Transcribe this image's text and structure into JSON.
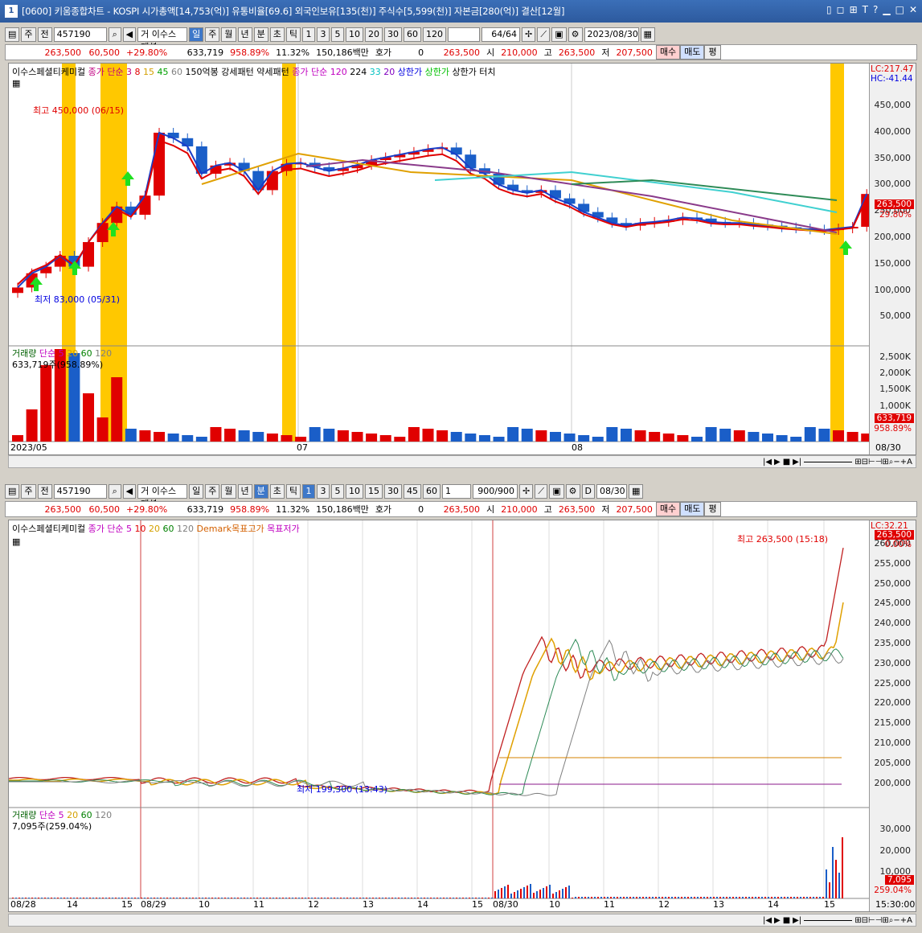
{
  "title": "[0600] 키움종합차트 - KOSPI 시가총액[14,753(억)] 유통비율[69.6] 외국인보유[135(천)] 주식수[5,599(천)] 자본금[280(억)] 결산[12월]",
  "window_num": "1",
  "win_controls": [
    "▯",
    "◻",
    "⊞",
    "T",
    "?",
    "▁",
    "□",
    "✕"
  ],
  "top": {
    "toolbar": {
      "mode": "주",
      "scope": "전",
      "code": "457190",
      "name": "거 이수스페셜",
      "periods": [
        "일",
        "주",
        "월",
        "년",
        "분",
        "초",
        "틱"
      ],
      "active_period": "일",
      "nums": [
        "1",
        "3",
        "5",
        "10",
        "20",
        "30",
        "60",
        "120"
      ],
      "count": "64/64",
      "date": "2023/08/30"
    },
    "quote": {
      "price": "263,500",
      "change": "60,500",
      "pct": "+29.80%",
      "volume": "633,719",
      "vol_pct": "958.89%",
      "turnover": "11.32%",
      "amount": "150,186백만",
      "hoga": "호가",
      "hoga_v": "0",
      "cur": "263,500",
      "open_l": "시",
      "open": "210,000",
      "high_l": "고",
      "high": "263,500",
      "low_l": "저",
      "low": "207,500",
      "buy": "매수",
      "sell": "매도",
      "avg": "평"
    },
    "legend_price": [
      {
        "t": "이수스페셜티케미컬",
        "c": "#000"
      },
      {
        "t": "종가 단순 3",
        "c": "#c00080"
      },
      {
        "t": "8",
        "c": "#e00000"
      },
      {
        "t": "15",
        "c": "#d4a000"
      },
      {
        "t": "45",
        "c": "#00a000"
      },
      {
        "t": "60",
        "c": "#808080"
      },
      {
        "t": "150억봉 강세패턴",
        "c": "#000"
      },
      {
        "t": "약세패턴",
        "c": "#000"
      },
      {
        "t": "종가 단순 120",
        "c": "#c000c0"
      },
      {
        "t": "224",
        "c": "#000"
      },
      {
        "t": "33",
        "c": "#00c0c0"
      },
      {
        "t": "20",
        "c": "#8000c0"
      },
      {
        "t": "상한가",
        "c": "#0000e0"
      },
      {
        "t": "상한가",
        "c": "#00c000"
      },
      {
        "t": "상한가 터치",
        "c": "#000"
      }
    ],
    "max_note": "최고 450,000 (06/15)",
    "min_note": "최저 83,000 (05/31)",
    "lc": "LC:217.47",
    "hc": "HC:-41.44",
    "y_ticks": [
      "450,000",
      "400,000",
      "350,000",
      "300,000",
      "250,000",
      "200,000",
      "150,000",
      "100,000",
      "50,000"
    ],
    "price_tag": "263,500",
    "price_pct": "29.80%",
    "legend_vol": [
      {
        "t": "거래량",
        "c": "#006000"
      },
      {
        "t": "단순 5",
        "c": "#c000c0"
      },
      {
        "t": "20",
        "c": "#d4a000"
      },
      {
        "t": "60",
        "c": "#008000"
      },
      {
        "t": "120",
        "c": "#808080"
      }
    ],
    "vol_note": "633,719주(958.89%)",
    "vol_ticks": [
      "2,500K",
      "2,000K",
      "1,500K",
      "1,000K"
    ],
    "vol_tag": "633,719",
    "vol_pct_tag": "958.89%",
    "x_ticks": [
      "2023/05",
      "07",
      "08"
    ],
    "x_end": "08/30"
  },
  "bottom": {
    "toolbar": {
      "mode": "주",
      "scope": "전",
      "code": "457190",
      "name": "거 이수스페셜",
      "periods": [
        "일",
        "주",
        "월",
        "년",
        "분",
        "초",
        "틱"
      ],
      "active_period": "분",
      "nums": [
        "1",
        "3",
        "5",
        "10",
        "15",
        "30",
        "45",
        "60"
      ],
      "active_num": "1",
      "unit": "1",
      "count": "900/900",
      "date": "08/30",
      "d": "D"
    },
    "quote": {
      "price": "263,500",
      "change": "60,500",
      "pct": "+29.80%",
      "volume": "633,719",
      "vol_pct": "958.89%",
      "turnover": "11.32%",
      "amount": "150,186백만",
      "hoga": "호가",
      "hoga_v": "0",
      "cur": "263,500",
      "open_l": "시",
      "open": "210,000",
      "high_l": "고",
      "high": "263,500",
      "low_l": "저",
      "low": "207,500",
      "buy": "매수",
      "sell": "매도",
      "avg": "평"
    },
    "legend_price": [
      {
        "t": "이수스페셜티케미컬",
        "c": "#000"
      },
      {
        "t": "종가 단순 5",
        "c": "#c000c0"
      },
      {
        "t": "10",
        "c": "#e00000"
      },
      {
        "t": "20",
        "c": "#d4a000"
      },
      {
        "t": "60",
        "c": "#008000"
      },
      {
        "t": "120",
        "c": "#808080"
      },
      {
        "t": "Demark목표고가",
        "c": "#d46000"
      },
      {
        "t": "목표저가",
        "c": "#c000c0"
      }
    ],
    "max_note": "최고 263,500 (15:18)",
    "min_note": "최저 199,300 (13:43)",
    "lc": "LC:32.21",
    "y_ticks": [
      "260,000",
      "255,000",
      "250,000",
      "245,000",
      "240,000",
      "235,000",
      "230,000",
      "225,000",
      "220,000",
      "215,000",
      "210,000",
      "205,000",
      "200,000"
    ],
    "price_tag": "263,500",
    "price_pct": "0.00%",
    "legend_vol": [
      {
        "t": "거래량",
        "c": "#006000"
      },
      {
        "t": "단순 5",
        "c": "#c000c0"
      },
      {
        "t": "20",
        "c": "#d4a000"
      },
      {
        "t": "60",
        "c": "#008000"
      },
      {
        "t": "120",
        "c": "#808080"
      }
    ],
    "vol_note": "7,095주(259.04%)",
    "vol_ticks": [
      "30,000",
      "20,000",
      "10,000"
    ],
    "vol_tag": "7,095",
    "vol_pct_tag": "259.04%",
    "x_ticks": [
      "08/28",
      "14",
      "15",
      "08/29",
      "10",
      "11",
      "12",
      "13",
      "14",
      "15",
      "08/30",
      "10",
      "11",
      "12",
      "13",
      "14",
      "15"
    ],
    "x_end": "15:30:00"
  },
  "colors": {
    "up": "#e00000",
    "down": "#1a5ec8",
    "highlight": "#ffc800"
  }
}
